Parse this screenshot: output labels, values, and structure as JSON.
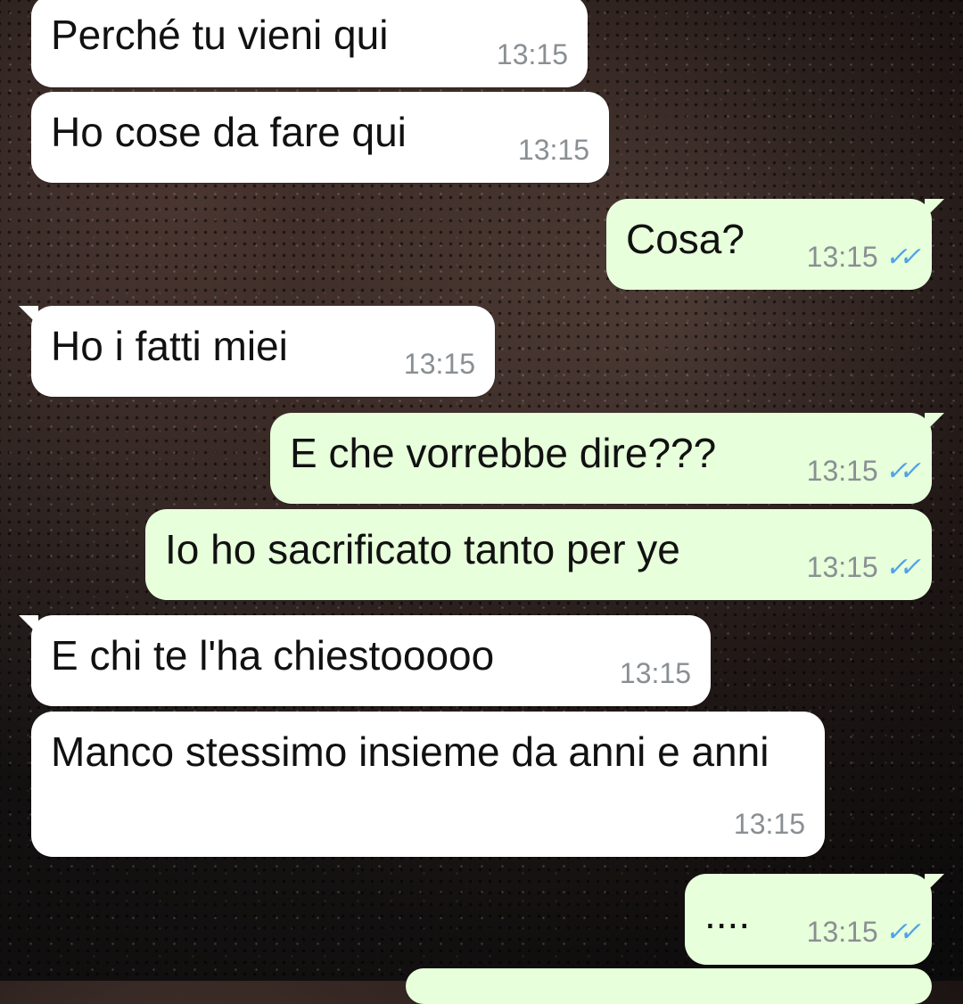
{
  "messages": [
    {
      "text": "Perché tu vieni qui",
      "time": "13:15"
    },
    {
      "text": "Ho cose da fare qui",
      "time": "13:15"
    },
    {
      "text": "Cosa?",
      "time": "13:15",
      "ticks": "✓✓"
    },
    {
      "text": "Ho i fatti miei",
      "time": "13:15"
    },
    {
      "text": "E che vorrebbe dire???",
      "time": "13:15",
      "ticks": "✓✓"
    },
    {
      "text": "Io ho sacrificato tanto per ye",
      "time": "13:15",
      "ticks": "✓✓"
    },
    {
      "text": "E chi te l'ha chiestooooo",
      "time": "13:15"
    },
    {
      "text": "Manco stessimo insieme da anni e anni",
      "time": "13:15"
    },
    {
      "text": "....",
      "time": "13:15",
      "ticks": "✓✓"
    }
  ]
}
